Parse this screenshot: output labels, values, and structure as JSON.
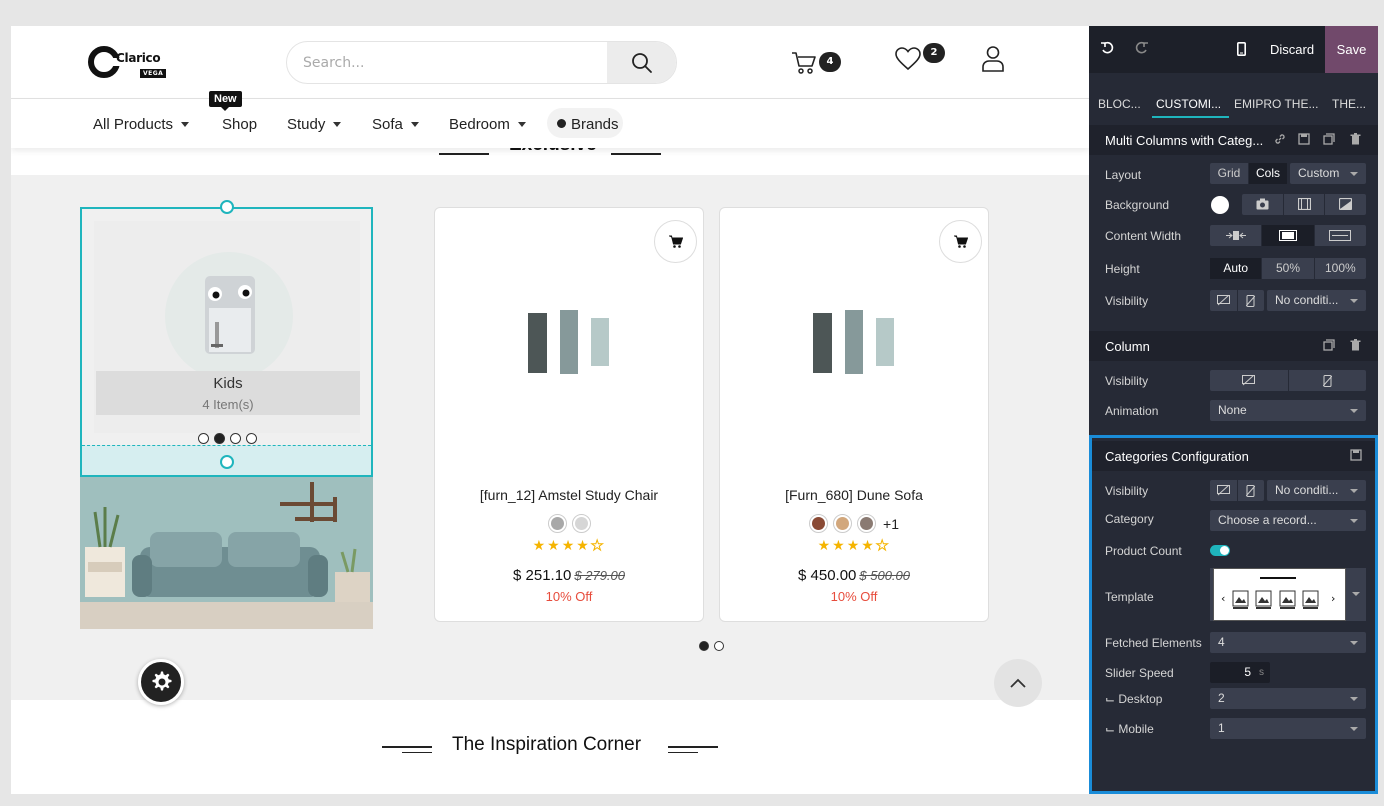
{
  "header": {
    "logo_text": "Clarico",
    "logo_tag": "VEGA",
    "search_placeholder": "Search...",
    "cart_count": "4",
    "wishlist_count": "2"
  },
  "nav": {
    "items": [
      "All Products",
      "Shop",
      "Study",
      "Sofa",
      "Bedroom",
      "Brands"
    ],
    "new_badge": "New"
  },
  "sections": {
    "exclusive_title": "Exclusive",
    "inspiration_title": "The Inspiration Corner"
  },
  "category_card": {
    "name": "Kids",
    "count": "4 Item(s)"
  },
  "products": [
    {
      "name": "[furn_12] Amstel Study Chair",
      "swatches": [
        "#a8a8a8",
        "#d6d6d6"
      ],
      "extra_swatches": "",
      "rating": 4,
      "price": "$ 251.10",
      "old_price": "$ 279.00",
      "discount": "10% Off"
    },
    {
      "name": "[Furn_680] Dune Sofa",
      "swatches": [
        "#8a4a35",
        "#d2a77c",
        "#8a7a72"
      ],
      "extra_swatches": "+1",
      "rating": 4,
      "price": "$ 450.00",
      "old_price": "$ 500.00",
      "discount": "10% Off"
    }
  ],
  "editor": {
    "discard": "Discard",
    "save": "Save",
    "tabs": [
      "BLOC...",
      "CUSTOMI...",
      "EMIPRO THE...",
      "THE..."
    ],
    "block_title": "Multi Columns with Categ...",
    "layout_label": "Layout",
    "layout_options": [
      "Grid",
      "Cols"
    ],
    "layout_custom": "Custom",
    "background_label": "Background",
    "content_width_label": "Content Width",
    "height_label": "Height",
    "height_options": [
      "Auto",
      "50%",
      "100%"
    ],
    "visibility_label": "Visibility",
    "no_condition": "No conditi...",
    "column_title": "Column",
    "animation_label": "Animation",
    "animation_value": "None",
    "config_title": "Categories Configuration",
    "category_label": "Category",
    "category_placeholder": "Choose a record...",
    "product_count_label": "Product Count",
    "template_label": "Template",
    "fetched_label": "Fetched Elements",
    "fetched_value": "4",
    "slider_speed_label": "Slider Speed",
    "slider_speed_value": "5",
    "slider_speed_unit": "s",
    "desktop_label": "⌙ Desktop",
    "desktop_value": "2",
    "mobile_label": "⌙ Mobile",
    "mobile_value": "1"
  }
}
